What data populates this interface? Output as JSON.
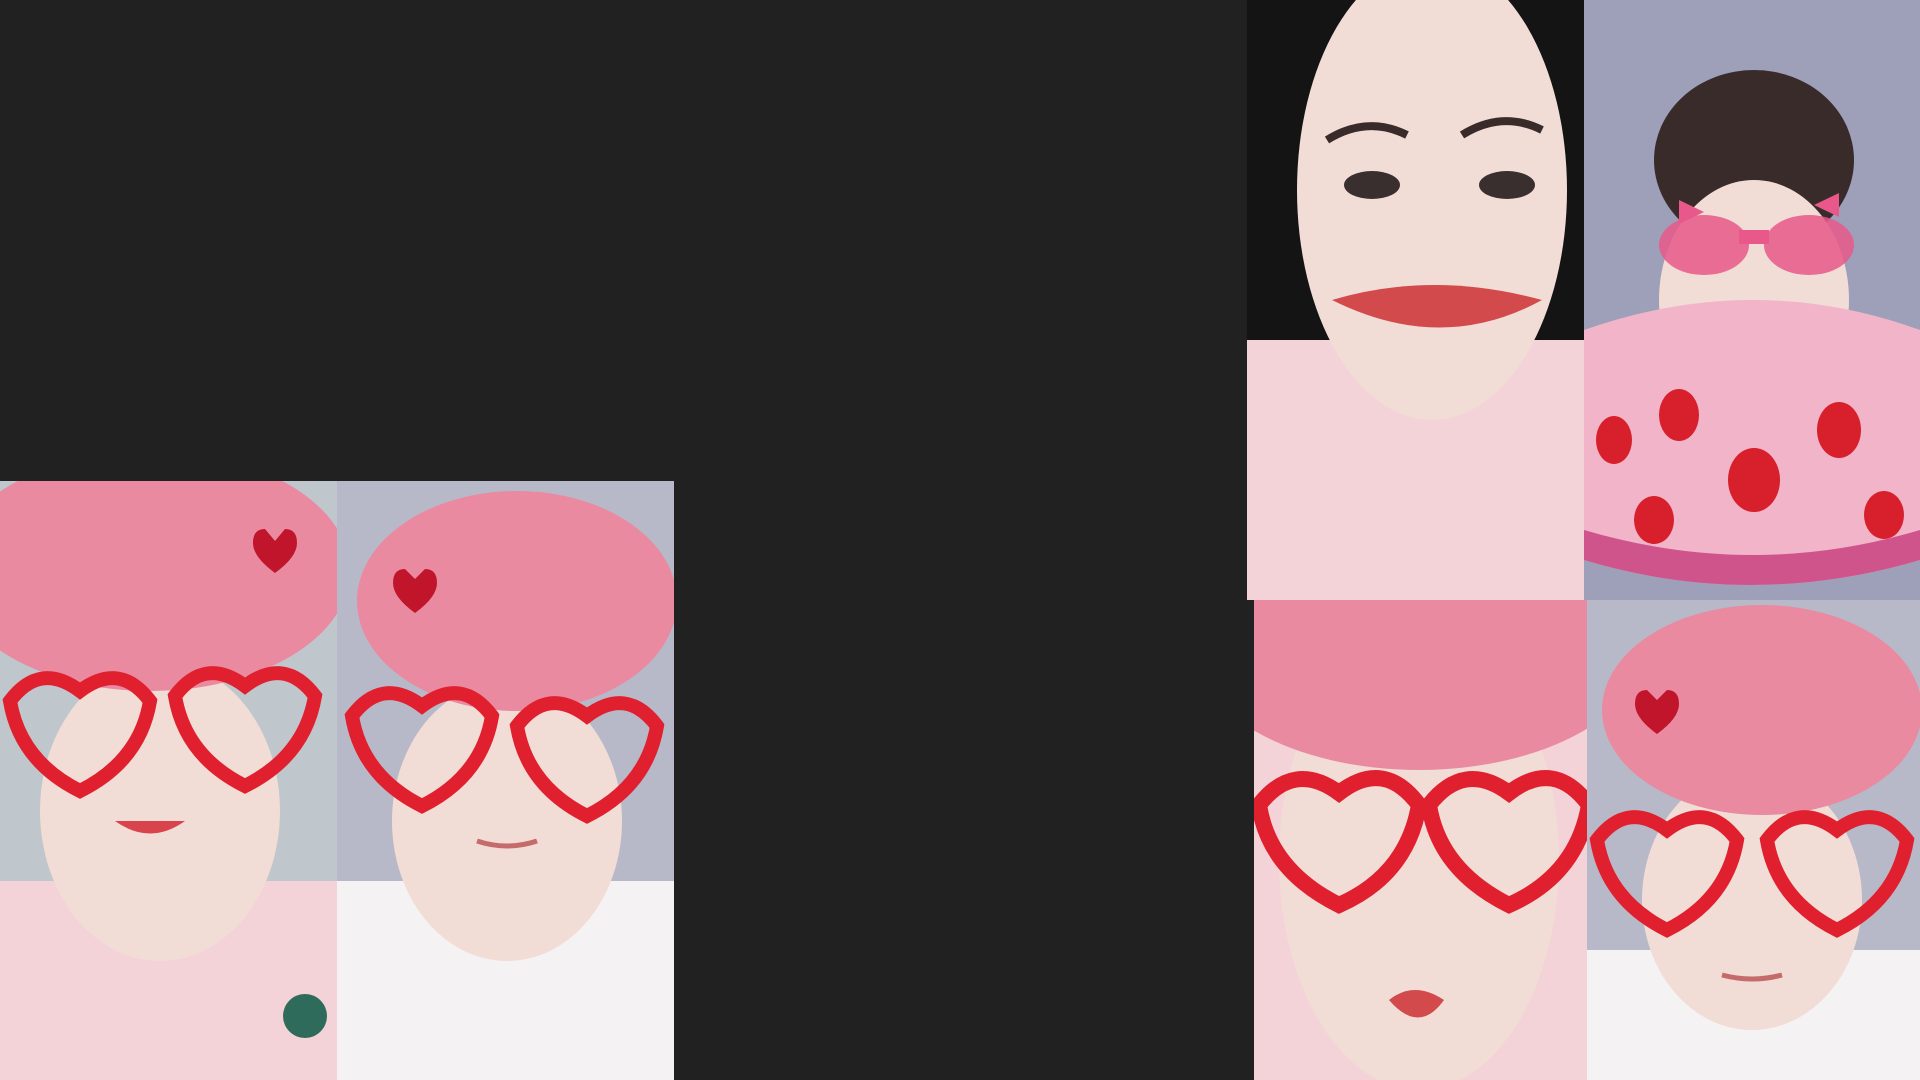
{
  "screen": {
    "background_color": "#212121"
  },
  "video_tiles": [
    {
      "id": "tile-a",
      "filter": "pink-beret-heart-glasses",
      "pose": "smiling"
    },
    {
      "id": "tile-b",
      "filter": "pink-beret-heart-glasses",
      "pose": "neutral"
    },
    {
      "id": "tile-c",
      "filter": "red-lips",
      "pose": "neutral"
    },
    {
      "id": "tile-d",
      "filter": "strawberry-float-pink-goggles",
      "pose": "mouth-open"
    },
    {
      "id": "tile-e",
      "filter": "pink-beret-heart-glasses",
      "pose": "pout"
    },
    {
      "id": "tile-f",
      "filter": "pink-beret-heart-glasses",
      "pose": "neutral"
    }
  ],
  "colors": {
    "beret": "#e98aa0",
    "heart_glasses": "#e0202e",
    "skin": "#f2dcd6",
    "shirt_pink": "#f3d3d8",
    "shirt_white": "#f4f2f2",
    "pillow": "#b8b9c8",
    "float_pink": "#f2b4c8",
    "strawberry": "#d8202c"
  }
}
